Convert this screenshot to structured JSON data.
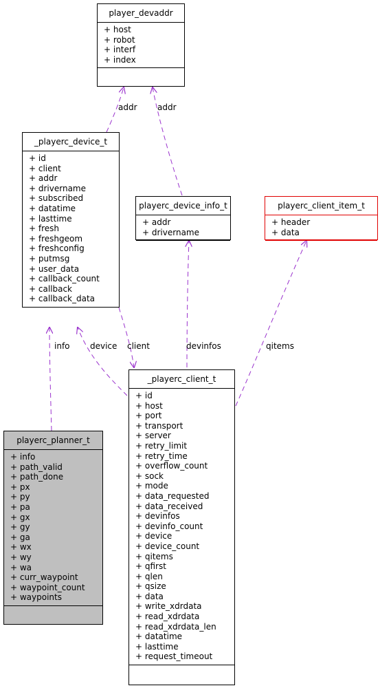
{
  "classes": {
    "player_devaddr": {
      "name": "player_devaddr",
      "attributes": [
        "+ host",
        "+ robot",
        "+ interf",
        "+ index"
      ]
    },
    "playerc_device_t": {
      "name": "_playerc_device_t",
      "attributes": [
        "+ id",
        "+ client",
        "+ addr",
        "+ drivername",
        "+ subscribed",
        "+ datatime",
        "+ lasttime",
        "+ fresh",
        "+ freshgeom",
        "+ freshconfig",
        "+ putmsg",
        "+ user_data",
        "+ callback_count",
        "+ callback",
        "+ callback_data"
      ]
    },
    "playerc_device_info_t": {
      "name": "playerc_device_info_t",
      "attributes": [
        "+ addr",
        "+ drivername"
      ]
    },
    "playerc_client_item_t": {
      "name": "playerc_client_item_t",
      "attributes": [
        "+ header",
        "+ data"
      ]
    },
    "playerc_planner_t": {
      "name": "playerc_planner_t",
      "attributes": [
        "+ info",
        "+ path_valid",
        "+ path_done",
        "+ px",
        "+ py",
        "+ pa",
        "+ gx",
        "+ gy",
        "+ ga",
        "+ wx",
        "+ wy",
        "+ wa",
        "+ curr_waypoint",
        "+ waypoint_count",
        "+ waypoints"
      ]
    },
    "playerc_client_t": {
      "name": "_playerc_client_t",
      "attributes": [
        "+ id",
        "+ host",
        "+ port",
        "+ transport",
        "+ server",
        "+ retry_limit",
        "+ retry_time",
        "+ overflow_count",
        "+ sock",
        "+ mode",
        "+ data_requested",
        "+ data_received",
        "+ devinfos",
        "+ devinfo_count",
        "+ device",
        "+ device_count",
        "+ qitems",
        "+ qfirst",
        "+ qlen",
        "+ qsize",
        "+ data",
        "+ write_xdrdata",
        "+ read_xdrdata",
        "+ read_xdrdata_len",
        "+ datatime",
        "+ lasttime",
        "+ request_timeout"
      ]
    }
  },
  "edges": {
    "addr1": "addr",
    "addr2": "addr",
    "info": "info",
    "device": "device",
    "client": "client",
    "devinfos": "devinfos",
    "qitems": "qitems"
  },
  "colors": {
    "edge": "#9a32cd",
    "highlight_border": "#e00000",
    "focus_fill": "#bfbfbf"
  }
}
